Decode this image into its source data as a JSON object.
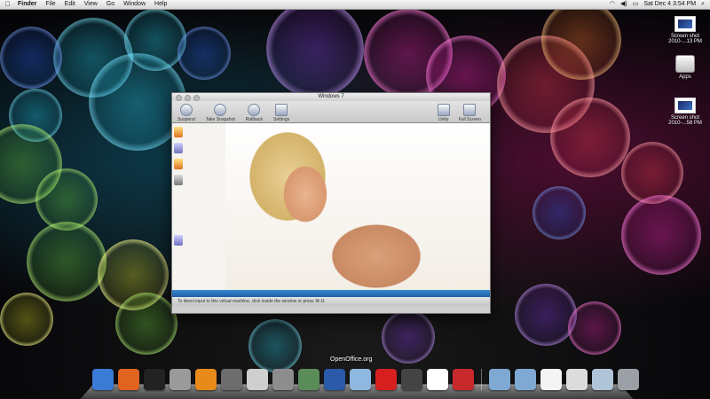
{
  "menubar": {
    "apple": "",
    "items": [
      "Finder",
      "File",
      "Edit",
      "View",
      "Go",
      "Window",
      "Help"
    ],
    "clock": "Sat Dec 4  3:54 PM"
  },
  "desktop_icons": [
    {
      "label": "Screen shot 2010-...13 PM",
      "icon": "screenshot-icon"
    },
    {
      "label": "Apps",
      "icon": "hard-drive-icon"
    },
    {
      "label": "Screen shot 2010-...58 PM",
      "icon": "screenshot-icon"
    }
  ],
  "vm_window": {
    "title": "Windows 7",
    "toolbar": {
      "suspend": "Suspend",
      "take_snapshot": "Take Snapshot",
      "rollback": "Rollback",
      "settings": "Settings",
      "unity": "Unity",
      "full_screen": "Full Screen"
    },
    "status_text": "To direct input to this virtual machine, click inside the window or press ⌘-G"
  },
  "dock": {
    "hover_label": "OpenOffice.org",
    "items": [
      {
        "name": "finder",
        "color": "#3a7bd5"
      },
      {
        "name": "firefox",
        "color": "#e0641f"
      },
      {
        "name": "terminal",
        "color": "#222222"
      },
      {
        "name": "stamp-app",
        "color": "#9a9a9a"
      },
      {
        "name": "vlc",
        "color": "#e88a1a"
      },
      {
        "name": "photo-app",
        "color": "#6d6d6d"
      },
      {
        "name": "preview",
        "color": "#cfcfcf"
      },
      {
        "name": "calculator",
        "color": "#8d8d8d"
      },
      {
        "name": "iphoto",
        "color": "#5a8c5a"
      },
      {
        "name": "openoffice",
        "color": "#2a5aa8"
      },
      {
        "name": "mail-app",
        "color": "#8fb8e0"
      },
      {
        "name": "ical",
        "color": "#d62020"
      },
      {
        "name": "steam",
        "color": "#444444"
      },
      {
        "name": "gmail",
        "color": "#ffffff"
      },
      {
        "name": "parallels",
        "color": "#c8292c"
      },
      {
        "name": "folder-1",
        "color": "#7fa9d3"
      },
      {
        "name": "folder-2",
        "color": "#7fa9d3"
      },
      {
        "name": "document",
        "color": "#f4f4f4"
      },
      {
        "name": "drive",
        "color": "#dcdcdc"
      },
      {
        "name": "stack",
        "color": "#b0c4d8"
      },
      {
        "name": "trash",
        "color": "#9aa0a6"
      }
    ]
  }
}
